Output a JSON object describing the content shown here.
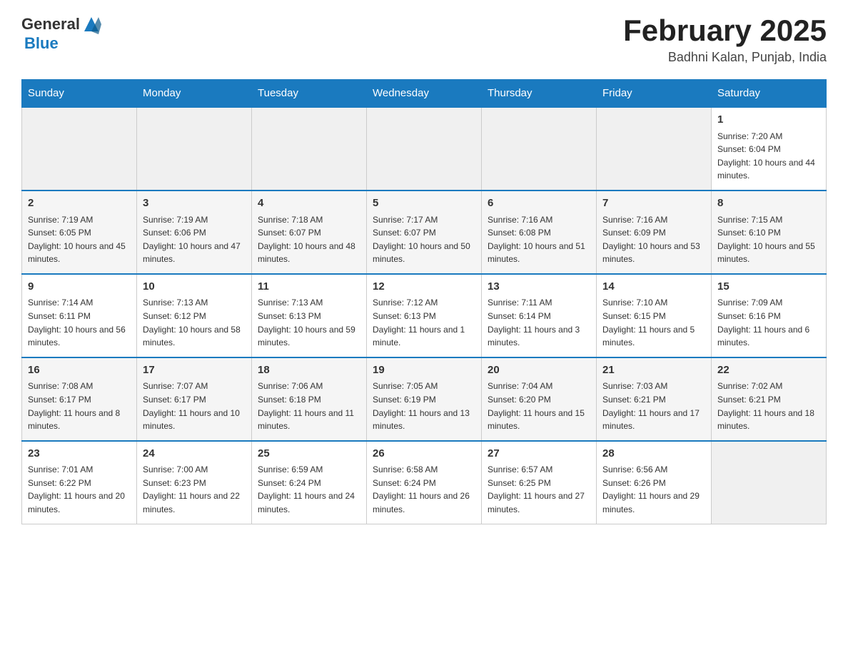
{
  "header": {
    "logo_general": "General",
    "logo_blue": "Blue",
    "month_title": "February 2025",
    "location": "Badhni Kalan, Punjab, India"
  },
  "days_of_week": [
    "Sunday",
    "Monday",
    "Tuesday",
    "Wednesday",
    "Thursday",
    "Friday",
    "Saturday"
  ],
  "weeks": [
    {
      "days": [
        {
          "num": "",
          "info": ""
        },
        {
          "num": "",
          "info": ""
        },
        {
          "num": "",
          "info": ""
        },
        {
          "num": "",
          "info": ""
        },
        {
          "num": "",
          "info": ""
        },
        {
          "num": "",
          "info": ""
        },
        {
          "num": "1",
          "info": "Sunrise: 7:20 AM\nSunset: 6:04 PM\nDaylight: 10 hours and 44 minutes."
        }
      ]
    },
    {
      "days": [
        {
          "num": "2",
          "info": "Sunrise: 7:19 AM\nSunset: 6:05 PM\nDaylight: 10 hours and 45 minutes."
        },
        {
          "num": "3",
          "info": "Sunrise: 7:19 AM\nSunset: 6:06 PM\nDaylight: 10 hours and 47 minutes."
        },
        {
          "num": "4",
          "info": "Sunrise: 7:18 AM\nSunset: 6:07 PM\nDaylight: 10 hours and 48 minutes."
        },
        {
          "num": "5",
          "info": "Sunrise: 7:17 AM\nSunset: 6:07 PM\nDaylight: 10 hours and 50 minutes."
        },
        {
          "num": "6",
          "info": "Sunrise: 7:16 AM\nSunset: 6:08 PM\nDaylight: 10 hours and 51 minutes."
        },
        {
          "num": "7",
          "info": "Sunrise: 7:16 AM\nSunset: 6:09 PM\nDaylight: 10 hours and 53 minutes."
        },
        {
          "num": "8",
          "info": "Sunrise: 7:15 AM\nSunset: 6:10 PM\nDaylight: 10 hours and 55 minutes."
        }
      ]
    },
    {
      "days": [
        {
          "num": "9",
          "info": "Sunrise: 7:14 AM\nSunset: 6:11 PM\nDaylight: 10 hours and 56 minutes."
        },
        {
          "num": "10",
          "info": "Sunrise: 7:13 AM\nSunset: 6:12 PM\nDaylight: 10 hours and 58 minutes."
        },
        {
          "num": "11",
          "info": "Sunrise: 7:13 AM\nSunset: 6:13 PM\nDaylight: 10 hours and 59 minutes."
        },
        {
          "num": "12",
          "info": "Sunrise: 7:12 AM\nSunset: 6:13 PM\nDaylight: 11 hours and 1 minute."
        },
        {
          "num": "13",
          "info": "Sunrise: 7:11 AM\nSunset: 6:14 PM\nDaylight: 11 hours and 3 minutes."
        },
        {
          "num": "14",
          "info": "Sunrise: 7:10 AM\nSunset: 6:15 PM\nDaylight: 11 hours and 5 minutes."
        },
        {
          "num": "15",
          "info": "Sunrise: 7:09 AM\nSunset: 6:16 PM\nDaylight: 11 hours and 6 minutes."
        }
      ]
    },
    {
      "days": [
        {
          "num": "16",
          "info": "Sunrise: 7:08 AM\nSunset: 6:17 PM\nDaylight: 11 hours and 8 minutes."
        },
        {
          "num": "17",
          "info": "Sunrise: 7:07 AM\nSunset: 6:17 PM\nDaylight: 11 hours and 10 minutes."
        },
        {
          "num": "18",
          "info": "Sunrise: 7:06 AM\nSunset: 6:18 PM\nDaylight: 11 hours and 11 minutes."
        },
        {
          "num": "19",
          "info": "Sunrise: 7:05 AM\nSunset: 6:19 PM\nDaylight: 11 hours and 13 minutes."
        },
        {
          "num": "20",
          "info": "Sunrise: 7:04 AM\nSunset: 6:20 PM\nDaylight: 11 hours and 15 minutes."
        },
        {
          "num": "21",
          "info": "Sunrise: 7:03 AM\nSunset: 6:21 PM\nDaylight: 11 hours and 17 minutes."
        },
        {
          "num": "22",
          "info": "Sunrise: 7:02 AM\nSunset: 6:21 PM\nDaylight: 11 hours and 18 minutes."
        }
      ]
    },
    {
      "days": [
        {
          "num": "23",
          "info": "Sunrise: 7:01 AM\nSunset: 6:22 PM\nDaylight: 11 hours and 20 minutes."
        },
        {
          "num": "24",
          "info": "Sunrise: 7:00 AM\nSunset: 6:23 PM\nDaylight: 11 hours and 22 minutes."
        },
        {
          "num": "25",
          "info": "Sunrise: 6:59 AM\nSunset: 6:24 PM\nDaylight: 11 hours and 24 minutes."
        },
        {
          "num": "26",
          "info": "Sunrise: 6:58 AM\nSunset: 6:24 PM\nDaylight: 11 hours and 26 minutes."
        },
        {
          "num": "27",
          "info": "Sunrise: 6:57 AM\nSunset: 6:25 PM\nDaylight: 11 hours and 27 minutes."
        },
        {
          "num": "28",
          "info": "Sunrise: 6:56 AM\nSunset: 6:26 PM\nDaylight: 11 hours and 29 minutes."
        },
        {
          "num": "",
          "info": ""
        }
      ]
    }
  ]
}
